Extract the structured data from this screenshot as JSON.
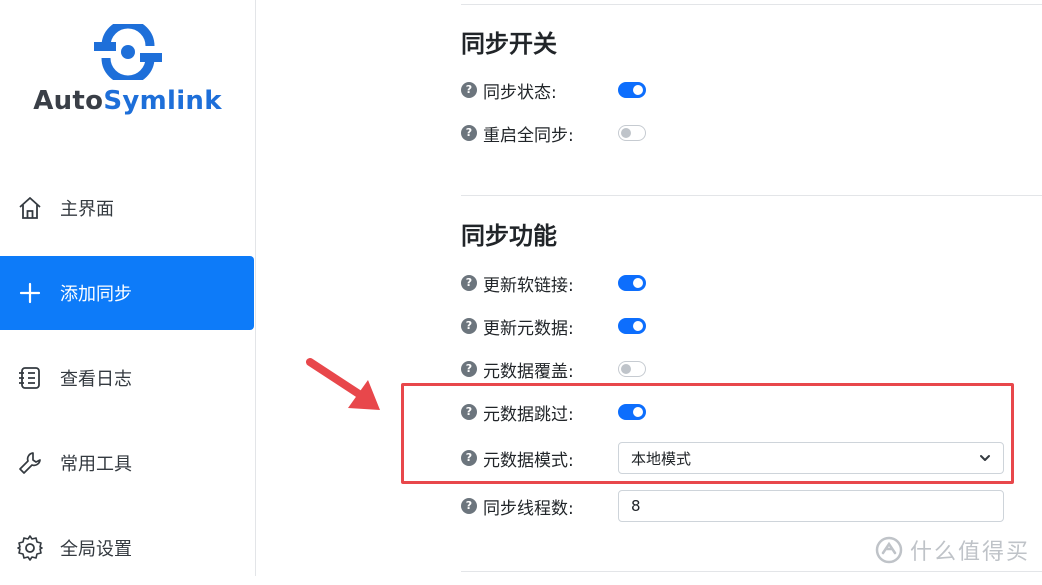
{
  "app": {
    "logo_part1": "Auto",
    "logo_part2": "Symlink"
  },
  "sidebar": {
    "items": [
      {
        "label": "主界面",
        "icon": "home-icon"
      },
      {
        "label": "添加同步",
        "icon": "plus-icon"
      },
      {
        "label": "查看日志",
        "icon": "log-icon"
      },
      {
        "label": "常用工具",
        "icon": "wrench-icon"
      },
      {
        "label": "全局设置",
        "icon": "gear-icon"
      }
    ],
    "active_index": 1
  },
  "sync_switch": {
    "title": "同步开关",
    "rows": [
      {
        "label": "同步状态:",
        "enabled": true
      },
      {
        "label": "重启全同步:",
        "enabled": false
      }
    ]
  },
  "sync_features": {
    "title": "同步功能",
    "rows": [
      {
        "label": "更新软链接:",
        "enabled": true
      },
      {
        "label": "更新元数据:",
        "enabled": true
      },
      {
        "label": "元数据覆盖:",
        "enabled": false
      },
      {
        "label": "元数据跳过:",
        "enabled": true
      }
    ],
    "metadata_mode": {
      "label": "元数据模式:",
      "value": "本地模式"
    },
    "thread_count": {
      "label": "同步线程数:",
      "value": "8"
    }
  },
  "help_glyph": "?",
  "watermark": {
    "text": "什么值得买"
  },
  "colors": {
    "primary": "#0d6efd",
    "sidebar_active": "#0d7bf9",
    "annotation": "#e8474b"
  }
}
